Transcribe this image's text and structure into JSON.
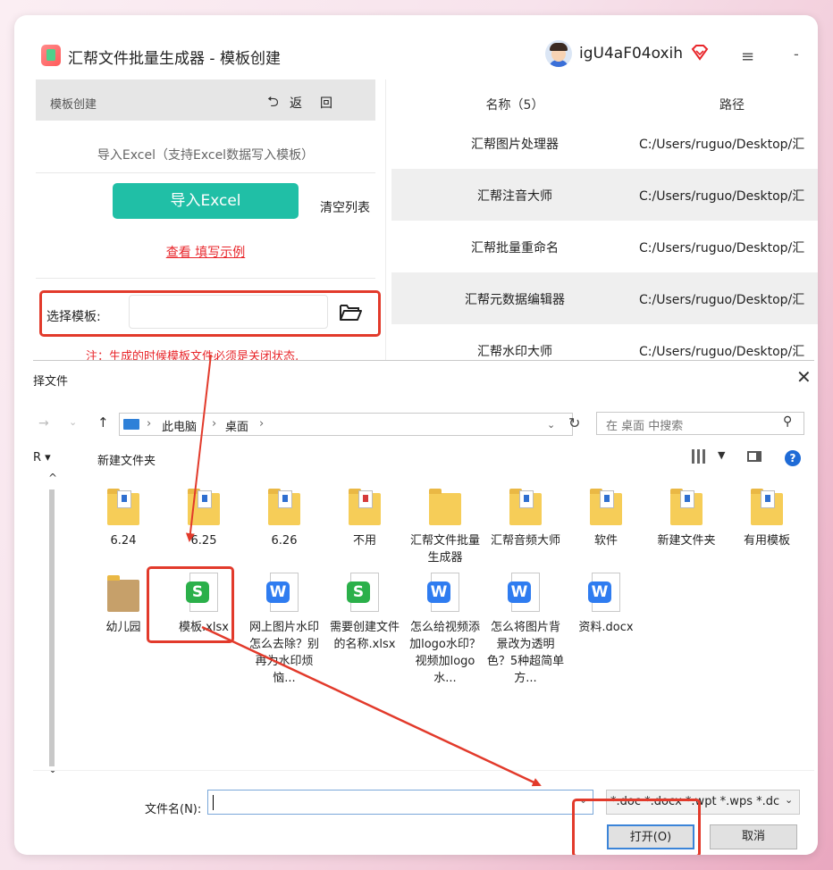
{
  "app": {
    "title": "汇帮文件批量生成器 - 模板创建",
    "username": "igU4aF04oxih"
  },
  "left_panel": {
    "header_title": "模板创建",
    "back_label": "返",
    "back_label2": "回",
    "import_hint": "导入Excel（支持Excel数据写入模板）",
    "import_button": "导入Excel",
    "clear_button": "清空列表",
    "example_link": "查看 填写示例",
    "select_label": "选择模板:",
    "note": "注：生成的时候模板文件必须是关闭状态,"
  },
  "table": {
    "headers": [
      "名称（5）",
      "路径"
    ],
    "rows": [
      {
        "name": "汇帮图片处理器",
        "path": "C:/Users/ruguo/Desktop/汇"
      },
      {
        "name": "汇帮注音大师",
        "path": "C:/Users/ruguo/Desktop/汇"
      },
      {
        "name": "汇帮批量重命名",
        "path": "C:/Users/ruguo/Desktop/汇"
      },
      {
        "name": "汇帮元数据编辑器",
        "path": "C:/Users/ruguo/Desktop/汇"
      },
      {
        "name": "汇帮水印大师",
        "path": "C:/Users/ruguo/Desktop/汇"
      }
    ]
  },
  "dialog": {
    "title": "择文件",
    "breadcrumb": [
      "此电脑",
      "桌面"
    ],
    "search_placeholder": "在 桌面 中搜索",
    "organize": "R ▾",
    "new_folder": "新建文件夹",
    "files_row1": [
      {
        "label": "6.24",
        "kind": "folder"
      },
      {
        "label": "6.25",
        "kind": "folder"
      },
      {
        "label": "6.26",
        "kind": "folder"
      },
      {
        "label": "不用",
        "kind": "folder-red"
      },
      {
        "label": "汇帮文件批量生成器",
        "kind": "folder-plain"
      },
      {
        "label": "汇帮音频大师",
        "kind": "folder"
      },
      {
        "label": "软件",
        "kind": "folder"
      },
      {
        "label": "新建文件夹",
        "kind": "folder"
      },
      {
        "label": "有用模板",
        "kind": "folder"
      }
    ],
    "files_row2": [
      {
        "label": "幼儿园",
        "kind": "folder-pic"
      },
      {
        "label": "模板.xlsx",
        "kind": "s"
      },
      {
        "label": "网上图片水印怎么去除？别再为水印烦恼...",
        "kind": "w"
      },
      {
        "label": "需要创建文件的名称.xlsx",
        "kind": "s"
      },
      {
        "label": "怎么给视频添加logo水印？视频加logo水...",
        "kind": "w"
      },
      {
        "label": "怎么将图片背景改为透明色？5种超简单方...",
        "kind": "w"
      },
      {
        "label": "资料.docx",
        "kind": "w"
      }
    ],
    "filename_label": "文件名(N):",
    "filename_value": "",
    "filetype": "*.doc *.docx *.wpt *.wps *.dc",
    "open_button": "打开(O)",
    "cancel_button": "取消"
  },
  "colors": {
    "accent": "#20bfa6",
    "highlight": "#e23a2b",
    "link": "#e8262b"
  }
}
